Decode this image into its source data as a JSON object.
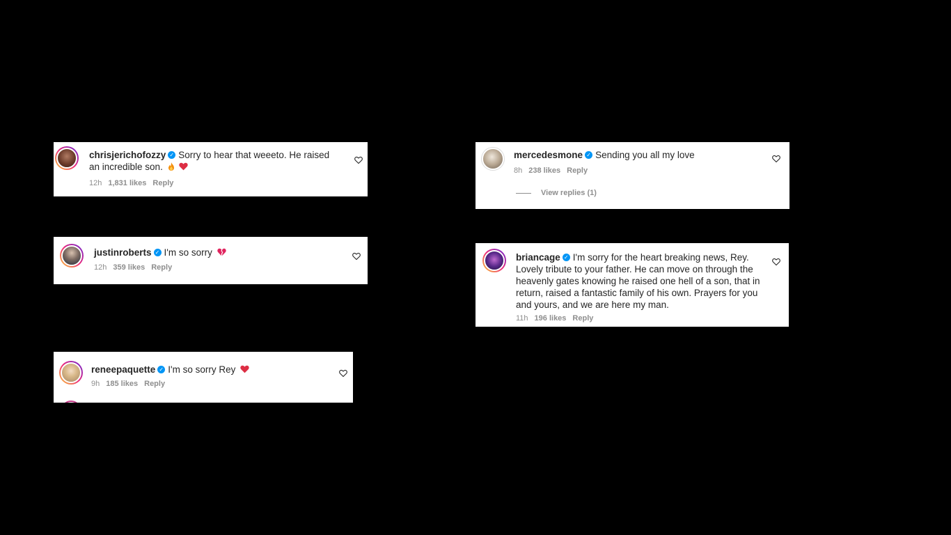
{
  "comments": [
    {
      "username": "chrisjerichofozzy",
      "text": "Sorry to hear that weeeto. He raised an incredible son.",
      "emojis": [
        "fire-icon",
        "red-heart-icon"
      ],
      "time": "12h",
      "likes": "1,831 likes",
      "reply": "Reply"
    },
    {
      "username": "justinroberts",
      "text": "I'm so sorry",
      "emojis": [
        "broken-heart-icon"
      ],
      "time": "12h",
      "likes": "359 likes",
      "reply": "Reply"
    },
    {
      "username": "reneepaquette",
      "text": "I'm so sorry Rey",
      "emojis": [
        "red-heart-icon"
      ],
      "time": "9h",
      "likes": "185 likes",
      "reply": "Reply"
    },
    {
      "username": "mercedesmone",
      "text": "Sending you all my love",
      "emojis": [],
      "time": "8h",
      "likes": "238 likes",
      "reply": "Reply",
      "view_replies": "View replies (1)"
    },
    {
      "username": "briancage",
      "text": "I'm sorry for the heart breaking news, Rey. Lovely tribute to your father. He can move on through the heavenly gates knowing he raised one hell of a son, that in return, raised a fantastic family of his own. Prayers for you and yours, and we are here my man.",
      "emojis": [],
      "time": "11h",
      "likes": "196 likes",
      "reply": "Reply"
    }
  ],
  "colors": {
    "background": "#000000",
    "card": "#ffffff",
    "verified": "#0095f6",
    "meta": "#8e8e8e",
    "heart": "#ed4956"
  }
}
